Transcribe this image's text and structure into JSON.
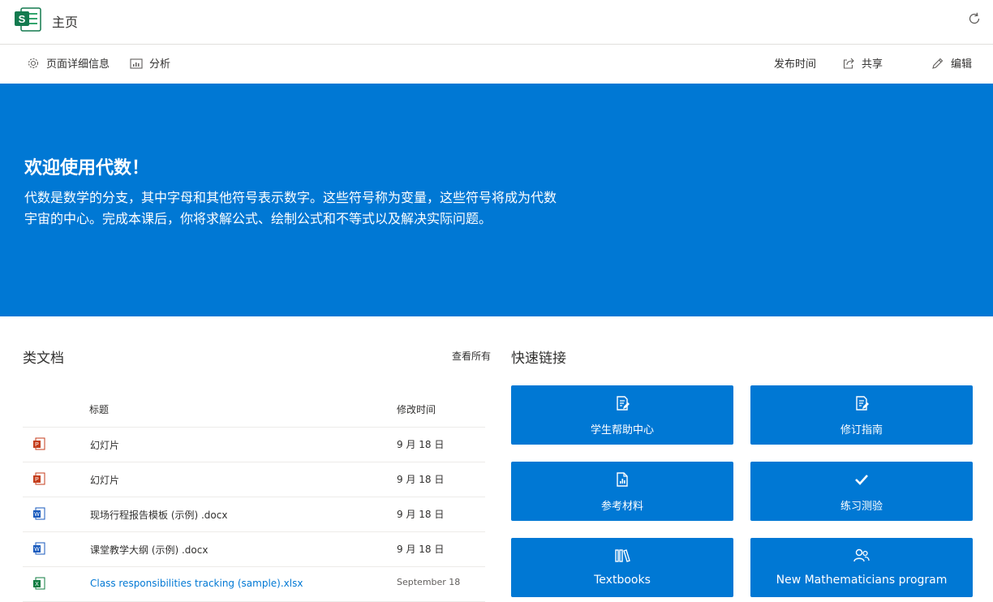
{
  "app": {
    "title": "主页"
  },
  "commandbar": {
    "page_details": "页面详细信息",
    "analytics": "分析",
    "publish_time": "发布时间",
    "share": "共享",
    "edit": "编辑"
  },
  "hero": {
    "title": "欢迎使用代数！",
    "text": "代数是数学的分支，其中字母和其他符号表示数字。这些符号称为变量，这些符号将成为代数宇宙的中心。完成本课后，你将求解公式、绘制公式和不等式以及解决实际问题。"
  },
  "documents": {
    "section_title": "类文档",
    "see_all": "查看所有",
    "col_title": "标题",
    "col_modified": "修改时间",
    "rows": [
      {
        "name": "幻灯片",
        "date": "9 月 18 日",
        "type": "ppt"
      },
      {
        "name": "幻灯片",
        "date": "9 月 18 日",
        "type": "ppt"
      },
      {
        "name": "现场行程报告模板 (示例) .docx",
        "date": "9 月 18 日",
        "type": "word"
      },
      {
        "name": "课堂教学大纲 (示例) .docx",
        "date": "9 月 18 日",
        "type": "word"
      },
      {
        "name": "Class responsibilities tracking (sample).xlsx",
        "date": "September 18",
        "type": "excel"
      }
    ]
  },
  "quicklinks": {
    "section_title": "快速链接",
    "items": [
      {
        "label": "学生帮助中心",
        "icon": "document-edit-icon"
      },
      {
        "label": "修订指南",
        "icon": "document-edit-icon"
      },
      {
        "label": "参考材料",
        "icon": "report-document-icon"
      },
      {
        "label": "练习测验",
        "icon": "checkmark-icon"
      },
      {
        "label": "Textbooks",
        "icon": "library-icon"
      },
      {
        "label": "New Mathematicians program",
        "icon": "people-icon"
      }
    ]
  },
  "colors": {
    "accent": "#0078d4",
    "ppt": "#c43e1c",
    "word": "#185abd",
    "excel": "#107c41"
  }
}
